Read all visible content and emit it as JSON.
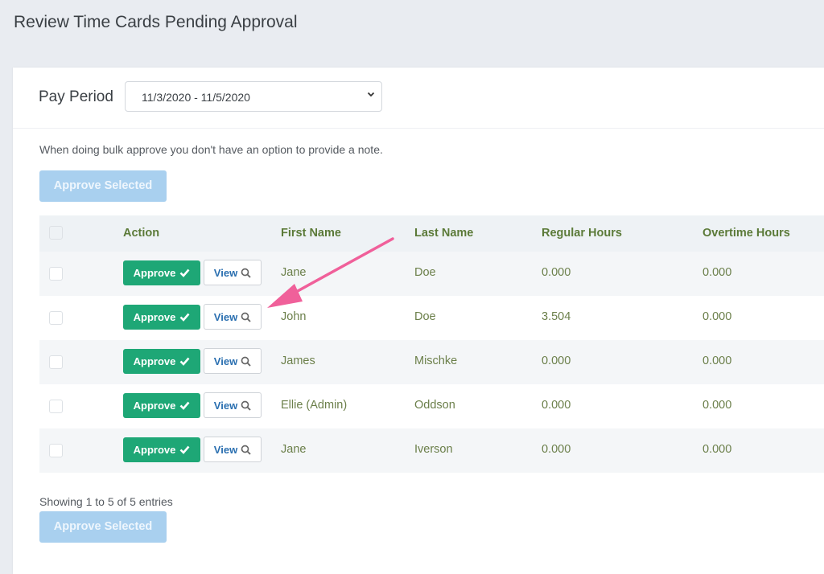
{
  "header": {
    "title": "Review Time Cards Pending Approval"
  },
  "pay_period": {
    "label": "Pay Period",
    "selected": "11/3/2020 - 11/5/2020"
  },
  "bulk_note": "When doing bulk approve you don't have an option to provide a note.",
  "approve_selected_label": "Approve Selected",
  "table": {
    "columns": [
      "Action",
      "First Name",
      "Last Name",
      "Regular Hours",
      "Overtime Hours"
    ],
    "approve_label": "Approve",
    "view_label": "View",
    "rows": [
      {
        "first_name": "Jane",
        "last_name": "Doe",
        "regular_hours": "0.000",
        "overtime_hours": "0.000"
      },
      {
        "first_name": "John",
        "last_name": "Doe",
        "regular_hours": "3.504",
        "overtime_hours": "0.000"
      },
      {
        "first_name": "James",
        "last_name": "Mischke",
        "regular_hours": "0.000",
        "overtime_hours": "0.000"
      },
      {
        "first_name": "Ellie (Admin)",
        "last_name": "Oddson",
        "regular_hours": "0.000",
        "overtime_hours": "0.000"
      },
      {
        "first_name": "Jane",
        "last_name": "Iverson",
        "regular_hours": "0.000",
        "overtime_hours": "0.000"
      }
    ]
  },
  "footer": {
    "showing": "Showing 1 to 5 of 5 entries"
  },
  "colors": {
    "approve_green": "#1ea776",
    "bulk_button_disabled": "#a9d0ef",
    "header_text_green": "#5b7a38",
    "annotation_arrow": "#f0609a"
  }
}
